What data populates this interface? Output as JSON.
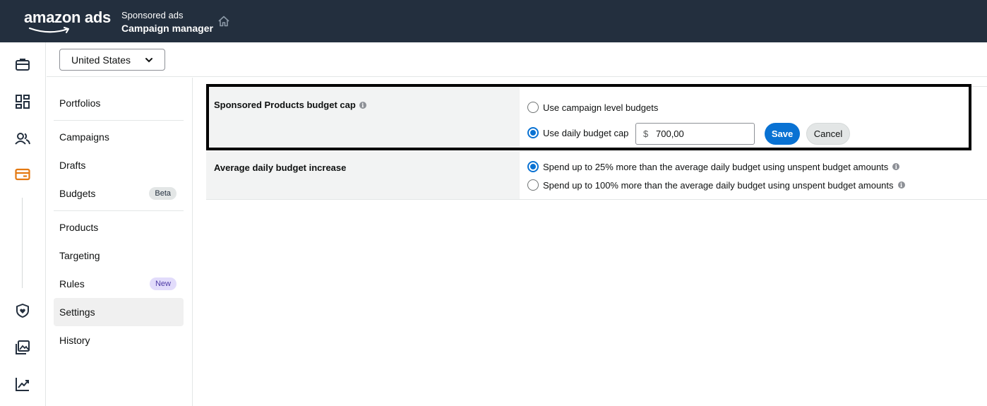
{
  "header": {
    "logo_text": "amazon ads",
    "product_subtitle": "Sponsored ads",
    "product_title": "Campaign manager",
    "home_icon": "home-icon",
    "background_color": "#232f3e"
  },
  "rail": {
    "icons": [
      "briefcase-icon",
      "dashboard-icon",
      "users-icon",
      "campaign-card-icon",
      "shield-heart-icon",
      "image-gallery-icon",
      "chart-line-icon"
    ],
    "active_icon": "campaign-card-icon",
    "accent_color": "#e47911"
  },
  "marketplace": {
    "selected": "United States"
  },
  "subnav": {
    "items": [
      {
        "label": "Portfolios"
      },
      {
        "label": "Campaigns"
      },
      {
        "label": "Drafts"
      },
      {
        "label": "Budgets",
        "badge": "Beta"
      },
      {
        "label": "Products"
      },
      {
        "label": "Targeting"
      },
      {
        "label": "Rules",
        "badge": "New"
      },
      {
        "label": "Settings",
        "active": true
      },
      {
        "label": "History"
      }
    ]
  },
  "settings": {
    "budget_cap": {
      "label": "Sponsored Products budget cap",
      "option_campaign": "Use campaign level budgets",
      "option_daily": "Use daily budget cap",
      "selected": "option_daily",
      "currency_symbol": "$",
      "amount": "700,00",
      "save_label": "Save",
      "cancel_label": "Cancel"
    },
    "daily_increase": {
      "label": "Average daily budget increase",
      "option_25": "Spend up to 25% more than the average daily budget using unspent budget amounts",
      "option_100": "Spend up to 100% more than the average daily budget using unspent budget amounts",
      "selected": "option_25"
    }
  },
  "colors": {
    "primary_blue": "#0972d3",
    "label_cell_bg": "#f2f3f3",
    "beta_badge_bg": "#e3e6e6",
    "new_badge_bg": "#e2dcfb"
  }
}
